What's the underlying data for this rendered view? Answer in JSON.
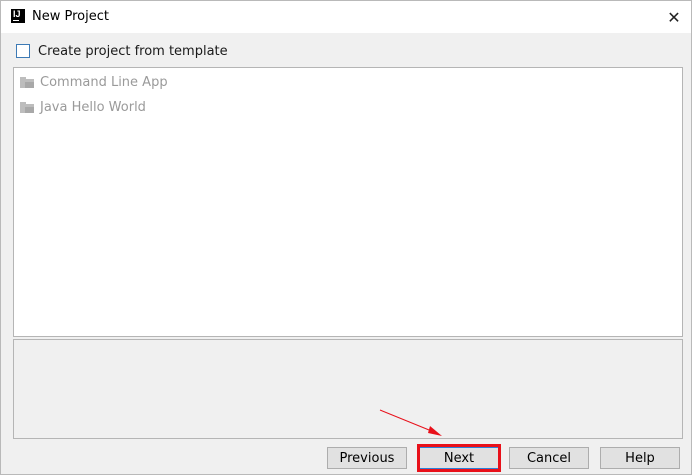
{
  "window": {
    "title": "New Project",
    "app_icon_text": "IJ",
    "close_glyph": "✕"
  },
  "template_checkbox": {
    "label": "Create project from template",
    "checked": false
  },
  "templates": [
    {
      "label": "Command Line App",
      "icon": "folder-icon"
    },
    {
      "label": "Java Hello World",
      "icon": "folder-icon"
    }
  ],
  "buttons": {
    "previous": "Previous",
    "next": "Next",
    "cancel": "Cancel",
    "help": "Help"
  },
  "colors": {
    "highlight": "#e8101a",
    "checkbox_border": "#3d7ab5",
    "disabled_text": "#9a9a9a"
  }
}
